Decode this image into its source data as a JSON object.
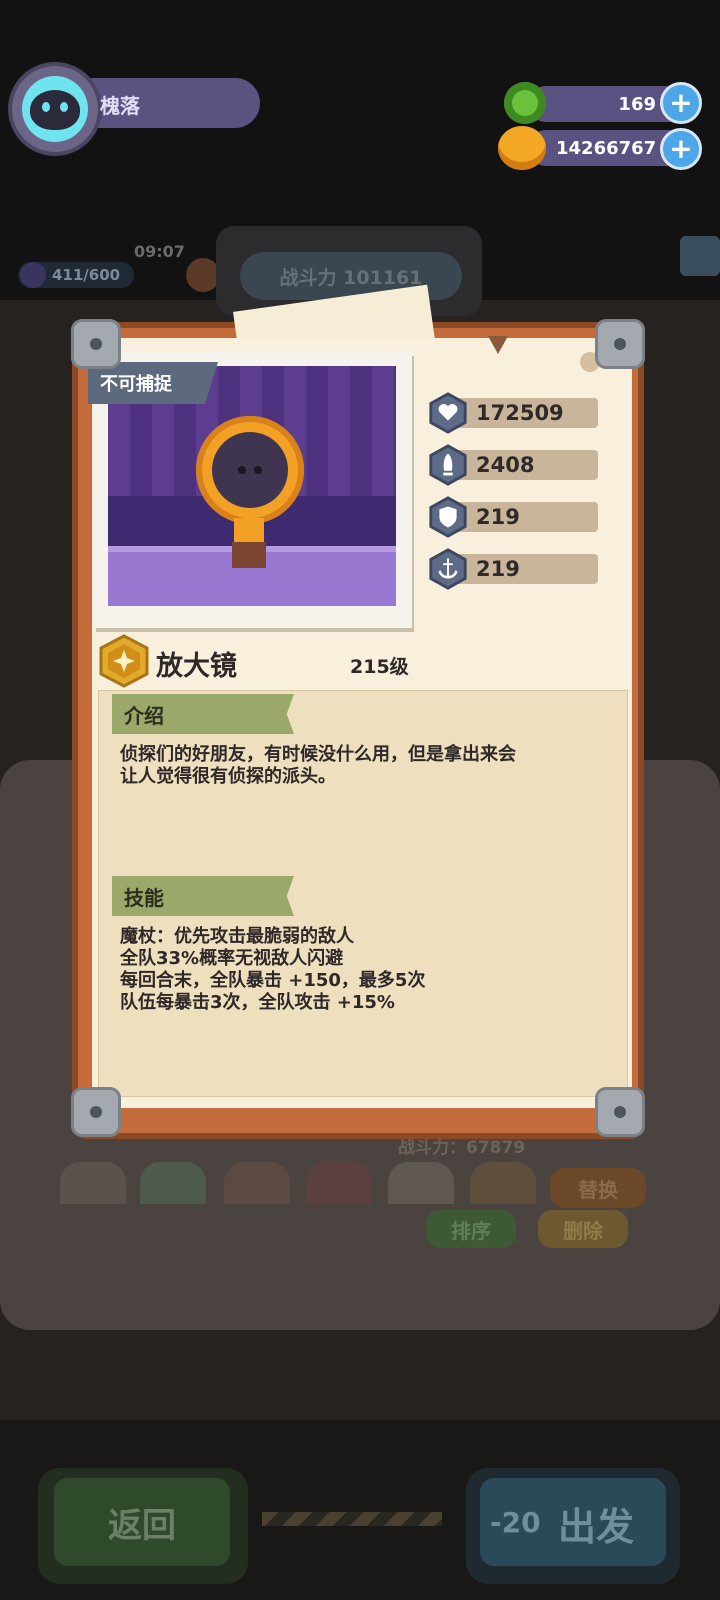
{
  "player": {
    "name": "槐落"
  },
  "resources": [
    {
      "icon": "green-gem-icon",
      "value": "169"
    },
    {
      "icon": "gold-coin-icon",
      "value": "14266767"
    }
  ],
  "background": {
    "time": "09:07",
    "energy": "411/600",
    "combat_power_top": "战斗力 101161",
    "combat_power_bottom": "战斗力：67879",
    "replace_label": "替换",
    "sort_label": "排序",
    "delete_label": "删除",
    "back_label": "返回",
    "depart_label": "出发",
    "depart_cost": "-20"
  },
  "card": {
    "capture_badge": "不可捕捉",
    "name": "放大镜",
    "level": "215级",
    "stats": [
      {
        "icon": "heart-icon",
        "value": "172509"
      },
      {
        "icon": "attack-icon",
        "value": "2408"
      },
      {
        "icon": "shield-icon",
        "value": "219"
      },
      {
        "icon": "anchor-icon",
        "value": "219"
      }
    ],
    "intro_title": "介绍",
    "intro_lines": [
      "侦探们的好朋友，有时候没什么用，但是拿出来会",
      "让人觉得很有侦探的派头。"
    ],
    "skill_title": "技能",
    "skill_lines": [
      "魔杖：优先攻击最脆弱的敌人",
      "全队33%概率无视敌人闪避",
      "每回合末，全队暴击 +150，最多5次",
      "队伍每暴击3次，全队攻击 +15%"
    ]
  }
}
